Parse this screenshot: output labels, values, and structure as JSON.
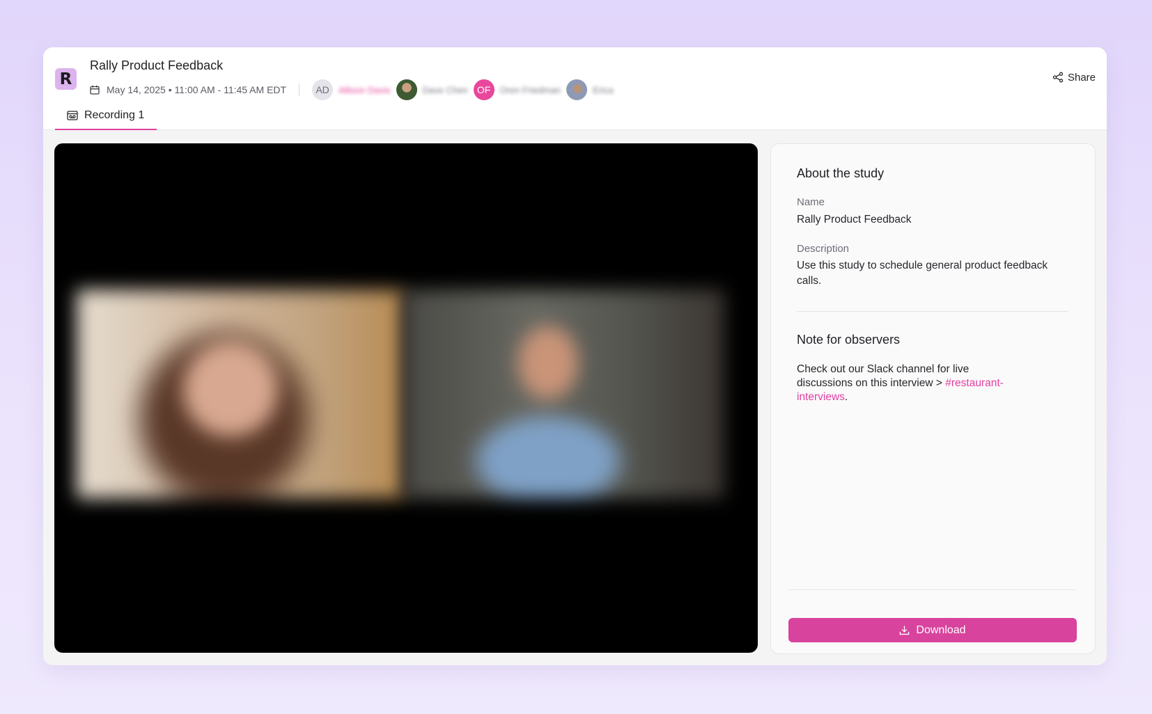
{
  "header": {
    "title": "Rally Product Feedback",
    "datetime": "May 14, 2025 • 11:00 AM - 11:45 AM EDT",
    "share_label": "Share",
    "logo_letter": "R",
    "participants": [
      {
        "initials": "AD",
        "name": "Allison Davis"
      },
      {
        "initials": "",
        "name": "Dave Chen"
      },
      {
        "initials": "OF",
        "name": "Oren Friedman"
      },
      {
        "initials": "",
        "name": "Erica"
      }
    ]
  },
  "tabs": [
    {
      "label": "Recording 1",
      "icon": "recording-icon",
      "active": true
    }
  ],
  "panel": {
    "heading": "About the study",
    "name_label": "Name",
    "name_value": "Rally Product Feedback",
    "description_label": "Description",
    "description_value": "Use this study to schedule general product feedback calls.",
    "note_heading": "Note for observers",
    "note_text": "Check out our Slack channel for live discussions on this interview > ",
    "note_link": "#restaurant-interviews",
    "note_suffix": ".",
    "download_label": "Download"
  },
  "colors": {
    "accent": "#d8439d",
    "link": "#e040a0",
    "logo_bg": "#dcb3ee"
  }
}
